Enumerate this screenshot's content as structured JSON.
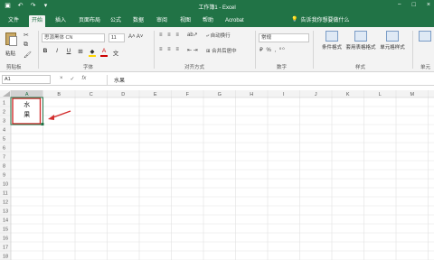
{
  "window": {
    "title": "工作簿1 - Excel",
    "controls": [
      "−",
      "□",
      "×"
    ]
  },
  "quick_access": [
    "save-icon",
    "undo-icon",
    "redo-icon",
    "customize-icon"
  ],
  "tabs": [
    "文件",
    "开始",
    "插入",
    "页面布局",
    "公式",
    "数据",
    "审阅",
    "视图",
    "帮助",
    "Acrobat"
  ],
  "active_tab": "开始",
  "tell_me": "告诉我你想要做什么",
  "ribbon": {
    "clipboard": {
      "paste_label": "粘贴",
      "group_label": "剪贴板"
    },
    "font": {
      "font_name": "思源黑体 CN",
      "font_size": "11",
      "group_label": "字体",
      "buttons": [
        "B",
        "I",
        "U",
        "A"
      ]
    },
    "alignment": {
      "wrap_text": "自动换行",
      "merge_center": "合并后居中",
      "group_label": "对齐方式"
    },
    "number": {
      "format": "常规",
      "group_label": "数字"
    },
    "styles": {
      "conditional": "条件格式",
      "table": "套用表格格式",
      "cell_styles": "单元格样式",
      "group_label": "样式"
    },
    "cells": {
      "label": "单元"
    }
  },
  "formula_bar": {
    "name_box": "A1",
    "content": "水果"
  },
  "sheet": {
    "columns": [
      "A",
      "B",
      "C",
      "D",
      "E",
      "F",
      "G",
      "H",
      "I",
      "J",
      "K",
      "L",
      "M"
    ],
    "rows": [
      "1",
      "2",
      "3",
      "4",
      "5",
      "6",
      "7",
      "8",
      "9",
      "10",
      "11",
      "12",
      "13",
      "14",
      "15",
      "16",
      "17",
      "18"
    ],
    "cell_a1": [
      "水",
      "果"
    ]
  },
  "colors": {
    "accent": "#217346",
    "annotation": "#d32f2f"
  }
}
